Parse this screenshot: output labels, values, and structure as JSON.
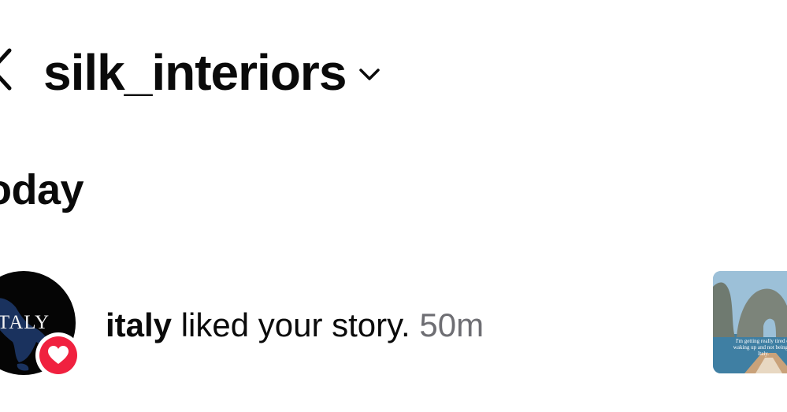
{
  "header": {
    "username": "silk_interiors",
    "back_icon": "chevron-left-icon",
    "switch_icon": "chevron-down-icon"
  },
  "section": {
    "heading": "oday"
  },
  "notifications": [
    {
      "avatar_text": "TALY",
      "user": "italy",
      "action": " liked your story.",
      "time": " 50m",
      "badge_icon": "heart-icon",
      "badge_color": "#f0213f",
      "thumbnail_caption": "I'm getting really tired of waking up and not being in Italy."
    }
  ],
  "colors": {
    "text": "#0a0a0a",
    "muted": "#6e6e73",
    "like_red": "#f0213f"
  }
}
